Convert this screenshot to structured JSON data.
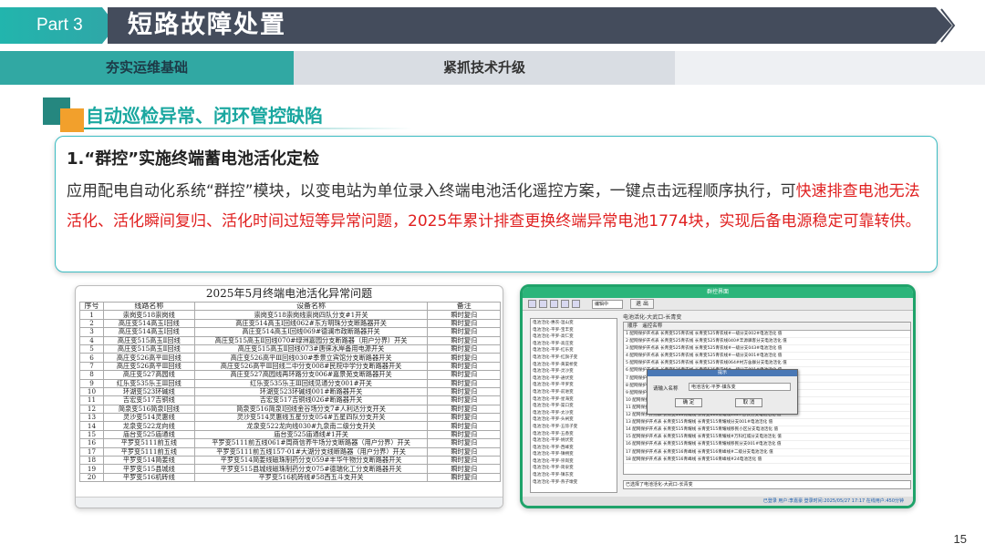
{
  "header": {
    "part_label": "Part 3",
    "title": "短路故障处置"
  },
  "subtabs": [
    {
      "label": "夯实运维基础"
    },
    {
      "label": "紧抓技术升级"
    }
  ],
  "section": {
    "title": "自动巡检异常、闭环管控缺陷"
  },
  "card": {
    "title": "1.“群控”实施终端蓄电池活化定检",
    "body_normal_1": "应用配电自动化系统“群控”模块，以变电站为单位录入终端电池活化遥控方案，一键点击远程顺序执行，可",
    "body_red": "快速排查电池无法活化、活化瞬间复归、活化时间过短等异常问题，2025年累计排查更换终端异常电池1774块，实现后备电源稳定可靠转供。"
  },
  "table_screenshot": {
    "title": "2025年5月终端电池活化异常问题",
    "columns": [
      "序号",
      "线路名称",
      "设备名称",
      "备注"
    ],
    "rows": [
      [
        "1",
        "崇岗变518崇岗线",
        "崇岗变518崇岗线崇岗四队分支#1开关",
        "瞬时复归"
      ],
      [
        "2",
        "高庄变514高玉Ⅰ回线",
        "高庄变514高玉Ⅰ回线062#东方明珠分支断路器开关",
        "瞬时复归"
      ],
      [
        "3",
        "高庄变514高玉Ⅰ回线",
        "高庄变514高玉Ⅰ回线069#德澜市政断路器开关",
        "瞬时复归"
      ],
      [
        "4",
        "高庄变515高玉Ⅱ回线",
        "高庄变515高玉Ⅱ回线070#绿洲嘉园分支断路器（用户分界）开关",
        "瞬时复归"
      ],
      [
        "5",
        "高庄变515高玉Ⅱ回线",
        "高庄变515高玉Ⅱ回线073#唐徕水岸备用电源开关",
        "瞬时复归"
      ],
      [
        "6",
        "高庄变526高平Ⅲ回线",
        "高庄变526高平Ⅲ回线030#季景立宾馆分支断路器开关",
        "瞬时复归"
      ],
      [
        "7",
        "高庄变526高平Ⅲ回线",
        "高庄变526高平Ⅲ回线二中分支008#民院中学分支断路器开关",
        "瞬时复归"
      ],
      [
        "8",
        "高庄变527高园线",
        "高庄变527高园线再环路分支006#嘉景苑支断路器开关",
        "瞬时复归"
      ],
      [
        "9",
        "红乐变535乐王Ⅲ回线",
        "红乐变535乐王Ⅲ回线见通分支001#开关",
        "瞬时复归"
      ],
      [
        "10",
        "环湖变523环碱线",
        "环湖变523环碱线001#断路器开关",
        "瞬时复归"
      ],
      [
        "11",
        "吉宏变517吉铜线",
        "吉宏变517吉铜线026#断路器开关",
        "瞬时复归"
      ],
      [
        "12",
        "简泉变516简泉Ⅰ回线",
        "简泉变516简泉Ⅰ回线金谷场分支7#人利达分支开关",
        "瞬时复归"
      ],
      [
        "13",
        "灵沙变514灵惠线",
        "灵沙变514灵惠线五星分支054#五星四队分支开关",
        "瞬时复归"
      ],
      [
        "14",
        "龙泉变522龙向线",
        "龙泉变522龙向线030#九泉南二级分支开关",
        "瞬时复归"
      ],
      [
        "15",
        "庙台变525庙通线",
        "庙台变525庙通线#1开关",
        "瞬时复归"
      ],
      [
        "16",
        "平罗变5111前五线",
        "平罗变5111前五线061#周商信养牛场分支断路器（用户分界）开关",
        "瞬时复归"
      ],
      [
        "17",
        "平罗变5111前五线",
        "平罗变5111前五线157-01#大湖分支线断路器（用户分界）开关",
        "瞬时复归"
      ],
      [
        "18",
        "平罗变514简姜线",
        "平罗变514简姜线磁珠制药分支059#丰华牛物分支断路器开关",
        "瞬时复归"
      ],
      [
        "19",
        "平罗变515县城线",
        "平罗变515县城线磁珠制药分支075#德瑞化工分支断路器开关",
        "瞬时复归"
      ],
      [
        "20",
        "平罗变516机砖线",
        "平罗变516机砖线#58西五斗支开关",
        "瞬时复归"
      ]
    ]
  },
  "app_screenshot": {
    "window_title": "群控界面",
    "toolbar_select": "编辑中",
    "exit_label": "退 出",
    "list_header": "电池活化-大武口-长青变",
    "grid_col_seq": "顺序",
    "grid_col_name": "遥控名称",
    "left_items": [
      "电池活化-惠农-温山变",
      "电池活化-平罗-宝丰变",
      "电池活化-平罗-高仁变",
      "电池活化-平罗-高庄变",
      "电池活化-平罗-红乐变",
      "电池活化-平罗-红旗子变",
      "电池活化-平罗-黄渠桥变",
      "电池活化-平罗-灵沙变",
      "电池活化-平罗-通伏变",
      "电池活化-平罗-平罗变",
      "电池活化-平罗-前进变",
      "电池活化-平罗-星海变",
      "电池活化-平罗-渠口变",
      "电池活化-平罗-太沙变",
      "电池活化-平罗-头闸变",
      "电池活化-平罗-五馀子变",
      "电池活化-平罗-五香变",
      "电池活化-平罗-姚伏变",
      "电池活化-平罗-西峰变",
      "电池活化-平罗-镇朔变",
      "电池活化-平罗-崇岗变",
      "电池活化-平罗-简泉变",
      "电池活化-平罗-镇东变",
      "电池活化-平罗-燕子墩变"
    ],
    "grid_rows": [
      "1  配网保护开点表 长青变525青农线 长青变525青农线#一级分支002#电池活化 值",
      "2  配网保护开点表 长青变525青农线 长青变525青农线040#丰源驿客分支电池活化 值",
      "3  配网保护开点表 长青变525青农线 长青变525青农线#一级分支043#电池活化 值",
      "4  配网保护开点表 长青变525青农线 长青变525青农线#一级分支001#电池活化 值",
      "5  配网保护开点表 长青变525青农线 长青变525青农线064#村方舍群分支电池活化 值",
      "6  配网保护开点表 长青变525青农线 长青变525青农线#一级分支091#电池活化 值",
      "7  配网保护开点表 长青变525青农线 长青变525青农线#108电池活化 值",
      "8  配网保护开点表 长青变525青农线 长青变525青农线#137电池活化 值",
      "9  配网保护开点表 长青变525青农线 长青变525青农线#140高盛一级分支电池活化 值",
      "10 配网保护开点表 长青变525青农线 长青变525青农线#146电池活化 值",
      "11 配网保护开点表 长青变525青农线 长青变525青农线#147电池活化 值",
      "12 配网保护开点表 长青变515青耀线 长青变515青耀线065#惠农分支电池活化 值",
      "13 配网保护开点表 长青变515青耀线 长青变515青耀线分支001#电池活化 值",
      "14 配网保护开点表 长青变515青耀线 长青变515青耀线移民小区分支电池活化 值",
      "15 配网保护开点表 长青变515青耀线 长青变515青耀线#万科红城分支电池活化 值",
      "16 配网保护开点表 长青变515青耀线 长青变515青耀线移民分支001#电池活化 值",
      "17 配网保护开点表 长青变516青峰线 长青变516青峰线#二级分支电池活化 值",
      "18 配网保护开点表 长青变516青峰线 长青变516青峰线#24电池活化 值"
    ],
    "dialog_title": "提示",
    "dialog_label": "请输入名称",
    "dialog_value": "电池活化-平罗-镇东变",
    "dialog_ok": "确 定",
    "dialog_cancel": "取 消",
    "status_text": "已选择了电池活化-大武口-长青变",
    "footer_text": "已登录  用户:李嘉豪  登录时间:2025/05/27 17:17  在线用户:450分钟"
  },
  "page_number": "15",
  "colors": {
    "teal": "#31a8a3",
    "dark_band": "#444c5c",
    "orange": "#f2a02c",
    "red_text": "#e02020"
  }
}
